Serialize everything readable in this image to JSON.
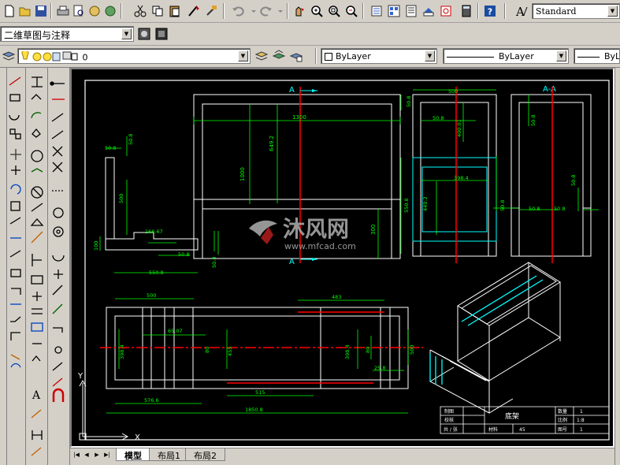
{
  "toolbar": {
    "text_style": "Standard"
  },
  "workspace": {
    "current": "二维草图与注释"
  },
  "layers": {
    "current_layer": "0",
    "color": "ByLayer",
    "linetype": "ByLayer",
    "lineweight": "ByL"
  },
  "tabs": [
    {
      "label": "模型"
    },
    {
      "label": "布局1"
    },
    {
      "label": "布局2"
    }
  ],
  "drawing": {
    "section_mark": "A",
    "section_title": "A-A",
    "front": {
      "width": "1300",
      "height_total": "1000",
      "height_inner": "649.2",
      "height_lower": "300",
      "left_small": "50.8",
      "small_dim": "50.8"
    },
    "side": {
      "w_top": "500",
      "dim_50_8": "50.8",
      "dim_400": "400.01",
      "inner": "398.4",
      "height": "550.8",
      "height_inner": "449.2",
      "dim_b": "50.8"
    },
    "left_detail": {
      "top": "50.8",
      "h1": "50.8",
      "h2": "500",
      "h3": "100",
      "w1": "166.67",
      "w2": "50.8",
      "w3": "550.8",
      "w4": "50.8"
    },
    "section_view": {
      "a": "50.8",
      "b": "50.8",
      "c": "50.8",
      "d": "50.8",
      "e": "50.8"
    },
    "plan": {
      "w500": "500",
      "w65": "65.07",
      "d80a": "80",
      "h398a": "398.4",
      "h455": "455",
      "w483": "483",
      "h398b": "398.4",
      "d80b": "80",
      "h500": "500",
      "w25": "25.8",
      "w515": "515",
      "w576": "576.6",
      "w1850": "1850.8"
    },
    "title_block": {
      "r1c1": "制图",
      "r2c1": "校核",
      "r3c1": "共 / 张",
      "name": "底架",
      "qty_label": "数量",
      "qty": "1",
      "scale_label": "比例",
      "scale": "1:8",
      "page_label": "图号",
      "page": "1",
      "mat_label": "材料",
      "mat": "45"
    }
  },
  "watermark": {
    "brand": "沐风网",
    "url": "www.mfcad.com"
  },
  "colors": {
    "canvas": "#000000",
    "object": "#ffffff",
    "dimension": "#00ff00",
    "center": "#ff0000",
    "cyan": "#00ffff",
    "ui": "#d4d0c8"
  }
}
